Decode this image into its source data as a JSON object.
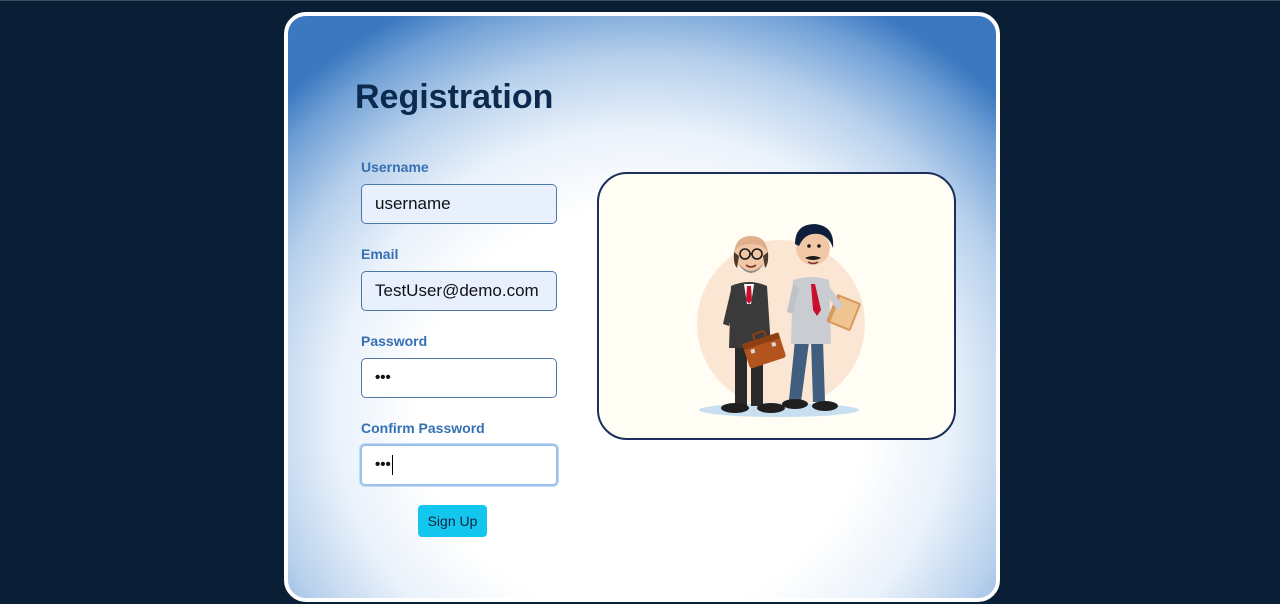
{
  "page": {
    "title": "Registration"
  },
  "form": {
    "username": {
      "label": "Username",
      "value": "username"
    },
    "email": {
      "label": "Email",
      "value": "TestUser@demo.com"
    },
    "password": {
      "label": "Password",
      "masked_value": "•••"
    },
    "confirm_password": {
      "label": "Confirm Password",
      "masked_value": "•••"
    },
    "submit_label": "Sign Up"
  },
  "illustration": {
    "icon": "two-businessmen-illustration"
  },
  "colors": {
    "background": "#0a1f35",
    "title": "#0c2a4e",
    "label": "#3570b3",
    "button": "#13c6ee",
    "card_gradient_edge": "#3b78c0"
  }
}
